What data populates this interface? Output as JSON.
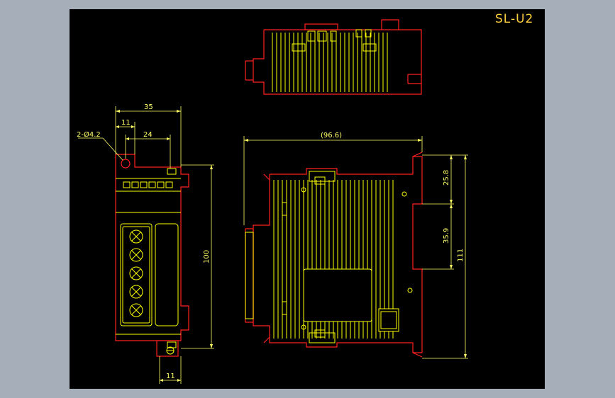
{
  "title": "SL-U2",
  "dimensions": {
    "width_35": "35",
    "offset_11_top": "11",
    "offset_24": "24",
    "hole_callout": "2-Ø4.2",
    "height_100": "100",
    "offset_11_bottom": "11",
    "depth_96_6": "(96.6)",
    "height_25_8": "25.8",
    "height_35_9": "35.9",
    "height_111": "111"
  },
  "colors": {
    "background": "#000000",
    "frame": "#a6aeb9",
    "outline": "#ff2020",
    "detail": "#ffff00",
    "dimension": "#ffff66",
    "title": "#ffd040"
  }
}
